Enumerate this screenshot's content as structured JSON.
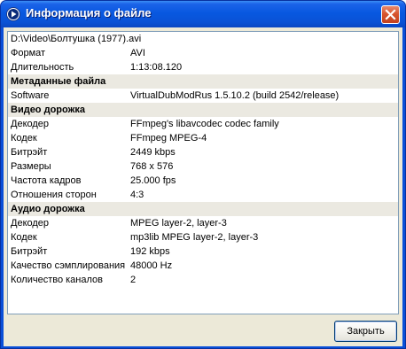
{
  "window": {
    "title": "Информация о файле",
    "icon": "media-play-icon"
  },
  "file": {
    "path": "D:\\Video\\Болтушка (1977).avi"
  },
  "general": [
    {
      "label": "Формат",
      "value": "AVI"
    },
    {
      "label": "Длительность",
      "value": "1:13:08.120"
    }
  ],
  "metadata": {
    "header": "Метаданные файла",
    "rows": [
      {
        "label": "Software",
        "value": "VirtualDubModRus 1.5.10.2 (build 2542/release)"
      }
    ]
  },
  "video": {
    "header": "Видео дорожка",
    "rows": [
      {
        "label": "Декодер",
        "value": "FFmpeg's libavcodec codec family"
      },
      {
        "label": "Кодек",
        "value": "FFmpeg MPEG-4"
      },
      {
        "label": "Битрэйт",
        "value": "2449 kbps"
      },
      {
        "label": "Размеры",
        "value": "768 x 576"
      },
      {
        "label": "Частота кадров",
        "value": "25.000 fps"
      },
      {
        "label": "Отношения сторон",
        "value": "4:3"
      }
    ]
  },
  "audio": {
    "header": "Аудио дорожка",
    "rows": [
      {
        "label": "Декодер",
        "value": "MPEG layer-2, layer-3"
      },
      {
        "label": "Кодек",
        "value": "mp3lib MPEG layer-2, layer-3"
      },
      {
        "label": "Битрэйт",
        "value": "192 kbps"
      },
      {
        "label": "Качество сэмплирования",
        "value": "48000 Hz"
      },
      {
        "label": "Количество каналов",
        "value": "2"
      }
    ]
  },
  "buttons": {
    "close_label": "Закрыть"
  },
  "colors": {
    "titlebar": "#0858e0",
    "section_bg": "#ebe9e1",
    "dialog_bg": "#ece9d8",
    "close_red": "#d7552f"
  }
}
